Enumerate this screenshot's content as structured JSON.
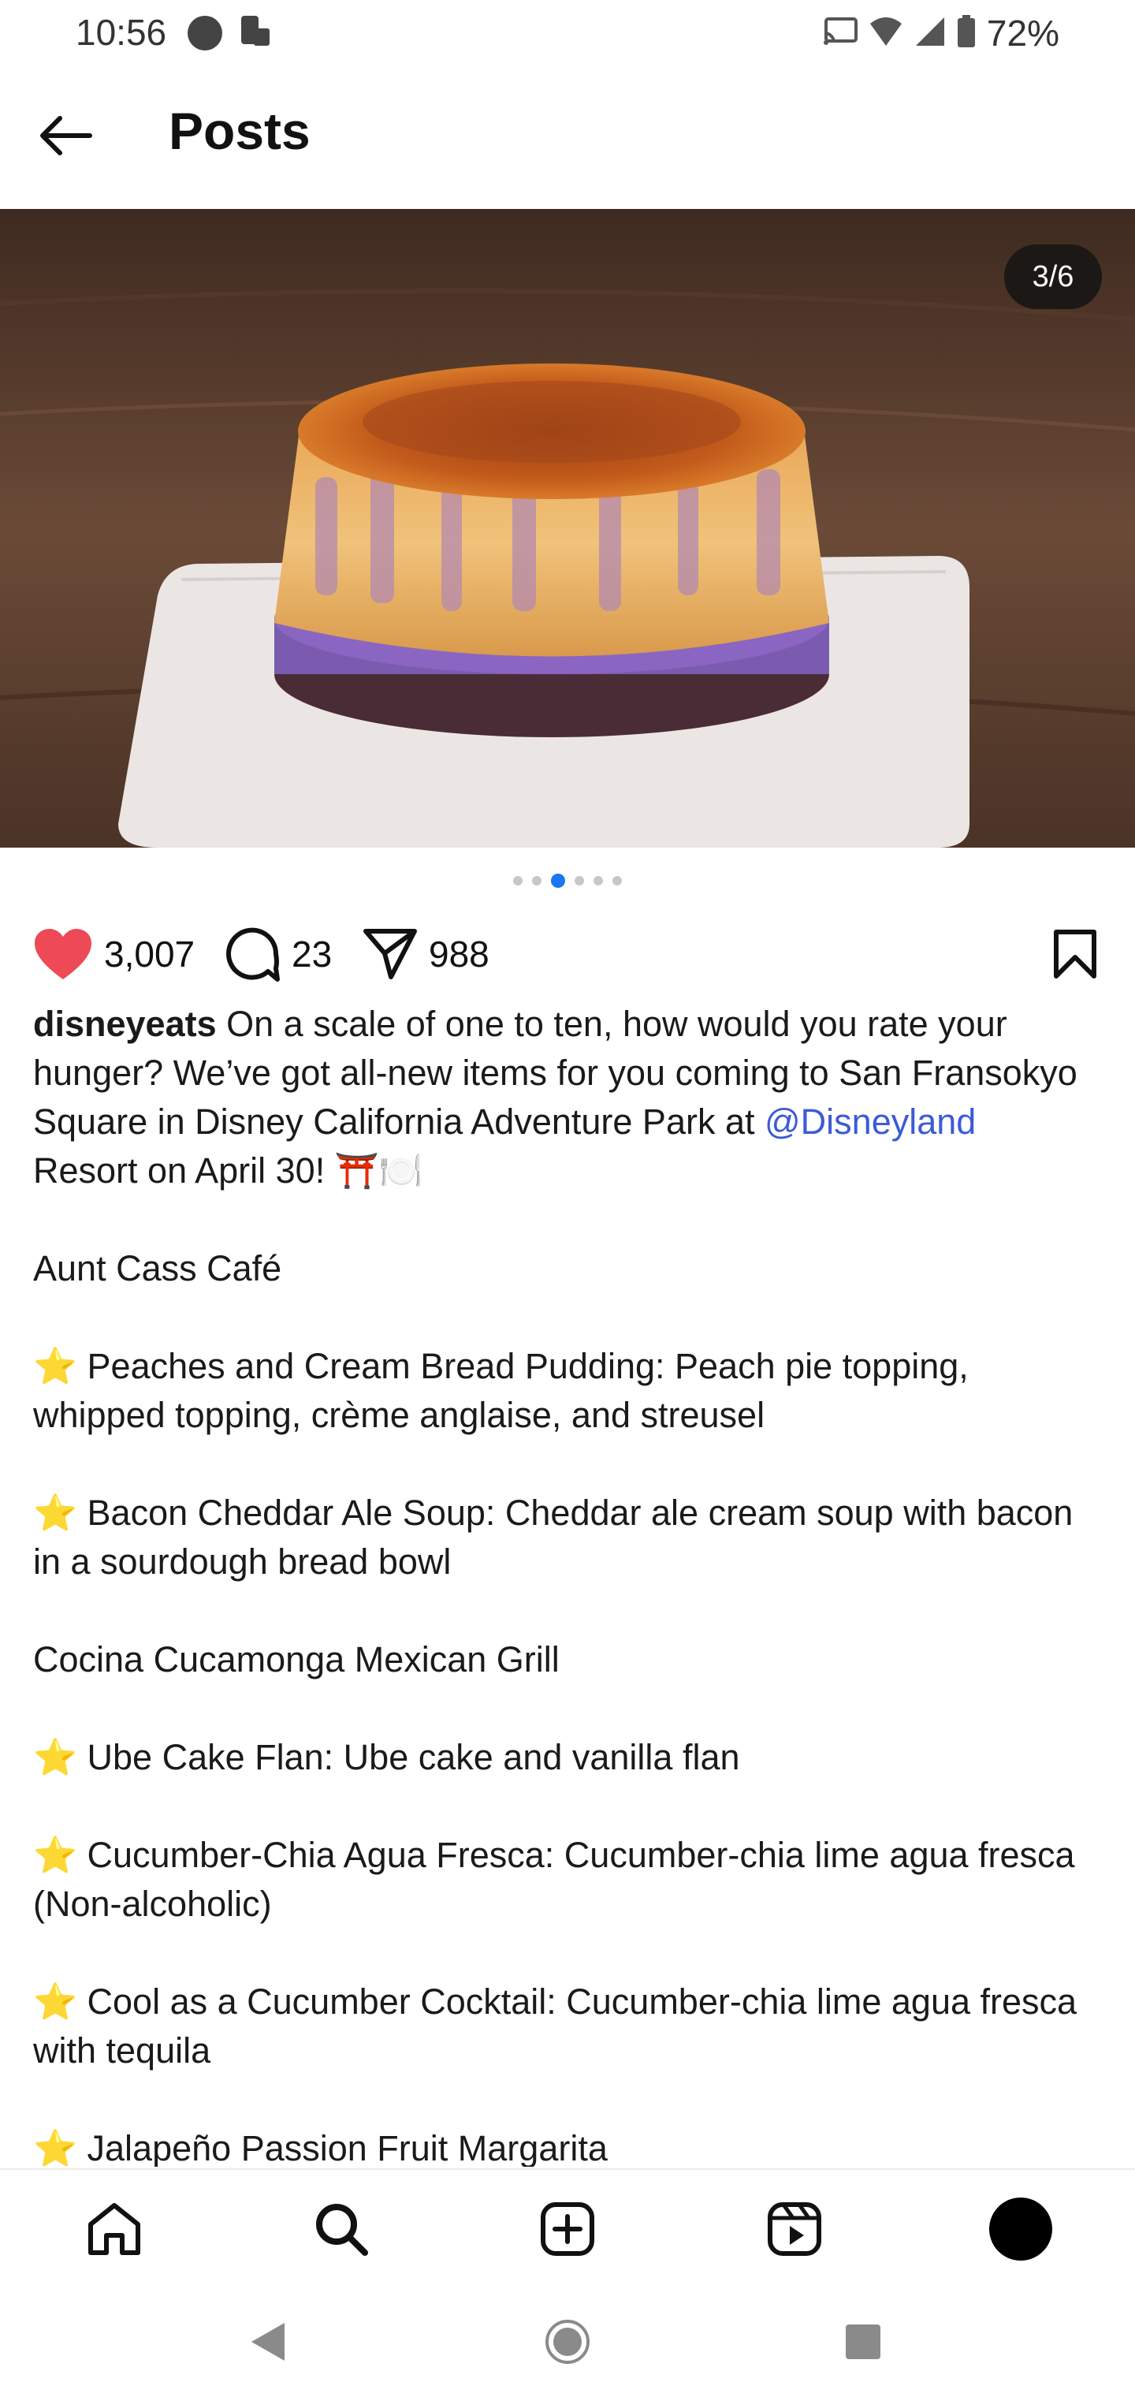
{
  "status_bar": {
    "time": "10:56",
    "battery_pct": "72%"
  },
  "header": {
    "title": "Posts"
  },
  "media": {
    "counter": "3/6",
    "slide_count": 6,
    "active_slide_index": 2
  },
  "actions": {
    "likes": "3,007",
    "comments": "23",
    "shares": "988",
    "like_color": "#ed4956"
  },
  "caption": {
    "username": "disneyeats",
    "intro_text": " On a scale of one to ten, how would you rate your hunger? We’ve got all-new items for you coming to San Fransokyo Square in Disney California Adventure Park at ",
    "mention": "@Disneyland",
    "intro_end": " Resort on April 30! ⛩️🍽️",
    "section1": "Aunt Cass Café",
    "item1": " Peaches and Cream Bread Pudding: Peach pie topping, whipped topping, crème anglaise, and streusel",
    "item2": " Bacon Cheddar Ale Soup: Cheddar ale cream soup with bacon in a sourdough bread bowl",
    "section2": "Cocina Cucamonga Mexican Grill",
    "item3": " Ube Cake Flan: Ube cake and vanilla flan",
    "item4": " Cucumber-Chia Agua Fresca: Cucumber-chia lime agua fresca (Non-alcoholic)",
    "item5": " Cool as a Cucumber Cocktail: Cucumber-chia lime agua fresca with tequila",
    "item6": " Jalapeño Passion Fruit Margarita",
    "star": "⭐"
  },
  "icons": {
    "back": "arrow-left-icon",
    "like": "heart-icon",
    "comment": "speech-bubble-icon",
    "share": "paper-plane-icon",
    "save": "bookmark-icon",
    "home": "home-icon",
    "search": "search-icon",
    "create": "plus-square-icon",
    "reels": "reels-icon"
  }
}
